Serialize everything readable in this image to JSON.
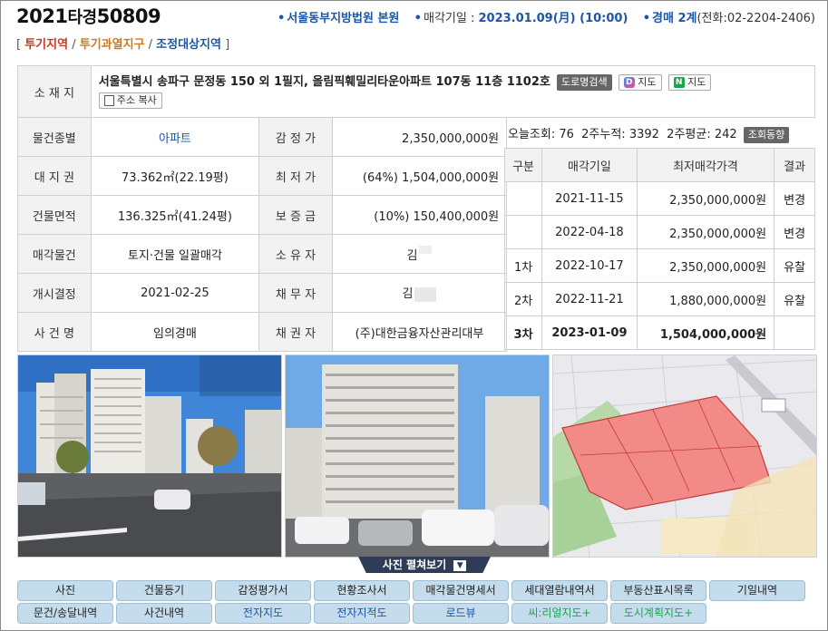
{
  "header": {
    "case_year": "2021",
    "case_type": "타경",
    "case_num": "50809",
    "court": "서울동부지방법원 본원",
    "sale_label": "매각기일 :",
    "sale_date": "2023.01.09(月) (10:00)",
    "dept": "경매 2계",
    "phone": "(전화:02-2204-2406)"
  },
  "tags": {
    "open": "[",
    "t1": "투기지역",
    "t2": "투기과열지구",
    "t3": "조정대상지역",
    "close": "]",
    "slash": "/"
  },
  "address": {
    "label": "소 재 지",
    "text": "서울특별시 송파구 문정동 150 외 1필지, 올림픽훼밀리타운아파트 107동 11층 1102호",
    "road_btn": "도로명검색",
    "map1": "지도",
    "map2": "지도",
    "copy": "주소 복사"
  },
  "rows": [
    {
      "l1": "물건종별",
      "v1": "아파트",
      "l2": "감 정 가",
      "v2": "2,350,000,000원"
    },
    {
      "l1": "대 지 권",
      "v1": "73.362㎡(22.19평)",
      "l2": "최 저 가",
      "v2": "(64%) 1,504,000,000원"
    },
    {
      "l1": "건물면적",
      "v1": "136.325㎡(41.24평)",
      "l2": "보 증 금",
      "v2": "(10%) 150,400,000원"
    },
    {
      "l1": "매각물건",
      "v1": "토지·건물 일괄매각",
      "l2": "소 유 자",
      "v2": "김"
    },
    {
      "l1": "개시결정",
      "v1": "2021-02-25",
      "l2": "채 무 자",
      "v2": "김"
    },
    {
      "l1": "사 건 명",
      "v1": "임의경매",
      "l2": "채 권 자",
      "v2": "(주)대한금융자산관리대부"
    }
  ],
  "stats": {
    "text": "오늘조회: 76  2주누적: 3392  2주평균: 242",
    "btn": "조회동향"
  },
  "history": {
    "headers": [
      "구분",
      "매각기일",
      "최저매각가격",
      "결과"
    ],
    "rows": [
      [
        "",
        "2021-11-15",
        "2,350,000,000원",
        "변경"
      ],
      [
        "",
        "2022-04-18",
        "2,350,000,000원",
        "변경"
      ],
      [
        "1차",
        "2022-10-17",
        "2,350,000,000원",
        "유찰"
      ],
      [
        "2차",
        "2022-11-21",
        "1,880,000,000원",
        "유찰"
      ],
      [
        "3차",
        "2023-01-09",
        "1,504,000,000원",
        ""
      ]
    ]
  },
  "photos": {
    "toggle": "사진 펼쳐보기"
  },
  "nav": {
    "row1": [
      "사진",
      "건물등기",
      "감정평가서",
      "현황조사서",
      "매각물건명세서",
      "세대열람내역서",
      "부동산표시목록",
      "기일내역"
    ],
    "row2": [
      "문건/송달내역",
      "사건내역",
      "전자지도",
      "전자지적도",
      "로드뷰",
      "씨:리얼지도+",
      "도시계획지도+"
    ]
  },
  "colors": {
    "accent_blue": "#1b56a8",
    "tag_red": "#c8381e",
    "tag_orange": "#d2781a",
    "nav_bg": "#c4dcec",
    "green": "#1aa64a"
  }
}
